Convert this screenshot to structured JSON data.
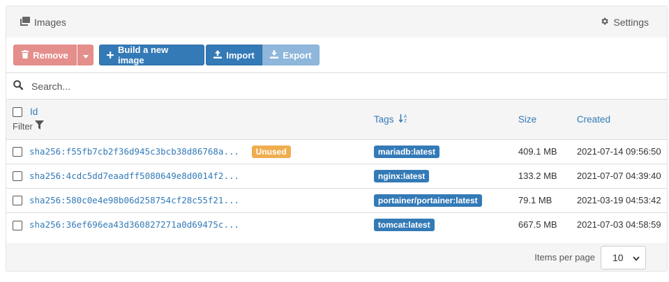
{
  "header": {
    "title": "Images",
    "settings_label": "Settings"
  },
  "toolbar": {
    "remove_label": "Remove",
    "build_label": "Build a new image",
    "import_label": "Import",
    "export_label": "Export"
  },
  "search": {
    "placeholder": "Search..."
  },
  "table": {
    "columns": {
      "id": "Id",
      "filter": "Filter",
      "tags": "Tags",
      "size": "Size",
      "created": "Created"
    },
    "rows": [
      {
        "id": "sha256:f55fb7cb2f36d945c3bcb38d86768a...",
        "unused": "Unused",
        "tag": "mariadb:latest",
        "size": "409.1 MB",
        "created": "2021-07-14 09:56:50"
      },
      {
        "id": "sha256:4cdc5dd7eaadff5080649e8d0014f2...",
        "unused": "",
        "tag": "nginx:latest",
        "size": "133.2 MB",
        "created": "2021-07-07 04:39:40"
      },
      {
        "id": "sha256:580c0e4e98b06d258754cf28c55f21...",
        "unused": "",
        "tag": "portainer/portainer:latest",
        "size": "79.1 MB",
        "created": "2021-03-19 04:53:42"
      },
      {
        "id": "sha256:36ef696ea43d360827271a0d69475c...",
        "unused": "",
        "tag": "tomcat:latest",
        "size": "667.5 MB",
        "created": "2021-07-03 04:58:59"
      }
    ]
  },
  "footer": {
    "items_per_page_label": "Items per page",
    "items_per_page_value": "10"
  },
  "colors": {
    "primary": "#337ab7",
    "danger_light": "#e58f8c",
    "warning": "#f0ad4e",
    "primary_light": "#8fb7dc"
  }
}
